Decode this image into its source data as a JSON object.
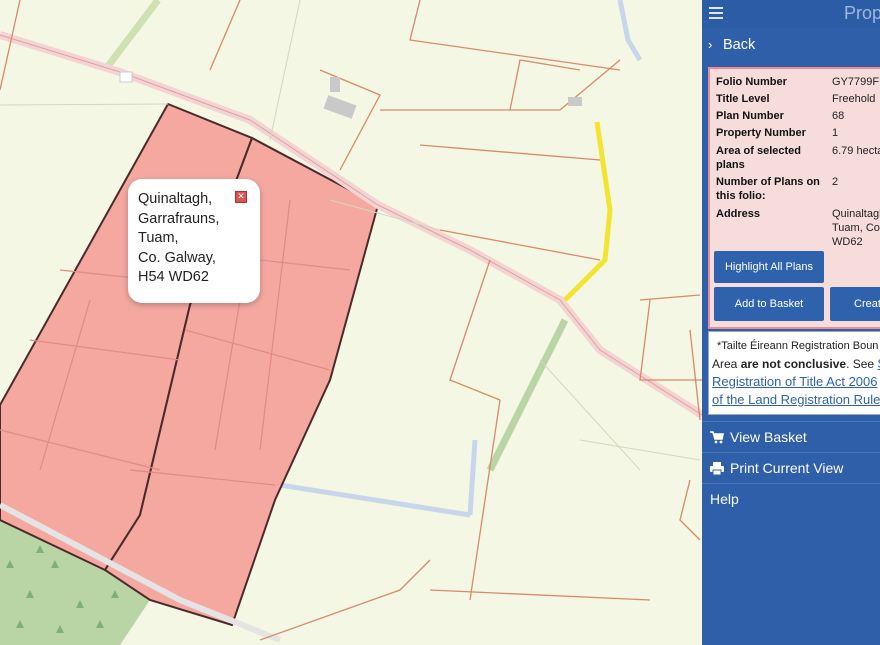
{
  "map": {
    "popup": {
      "address_lines": [
        "Quinaltagh,",
        "Garrafrauns,",
        "Tuam,",
        "Co. Galway,",
        "H54 WD62"
      ]
    }
  },
  "panel": {
    "title": "Prop",
    "back_label": "Back",
    "details": [
      {
        "label": "Folio Number",
        "value": "GY7799F"
      },
      {
        "label": "Title Level",
        "value": "Freehold"
      },
      {
        "label": "Plan Number",
        "value": "68"
      },
      {
        "label": "Property Number",
        "value": "1"
      },
      {
        "label": "Area of selected",
        "label2": "plans",
        "value": "6.79 hecta"
      },
      {
        "label": "Number of Plans on",
        "label2": "this folio:",
        "value": "2"
      },
      {
        "label": "Address",
        "value": "Quinaltagh",
        "value2": "Tuam, Co.",
        "value3": "WD62"
      }
    ],
    "buttons": {
      "highlight_all": "Highlight All Plans",
      "add_to_basket": "Add to Basket",
      "create": "Creat"
    },
    "notice": {
      "line1": "*Tailte Éireann Registration Boun",
      "line2_pre": "Area ",
      "line2_bold": "are not conclusive",
      "line2_post": ". See ",
      "line2_link": "Se",
      "line3_link": "Registration of Title Act 2006",
      "line4_link": "of the Land Registration Rule"
    },
    "nav": [
      {
        "label": "View Basket",
        "icon": "cart-icon"
      },
      {
        "label": "Print Current View",
        "icon": "print-icon"
      },
      {
        "label": "Help"
      }
    ]
  },
  "colors": {
    "panel_bg": "#2e5fa8",
    "parcel_fill": "#f4a8a0",
    "highlight_road": "#f2e430",
    "info_bg": "#f7dcdc"
  }
}
